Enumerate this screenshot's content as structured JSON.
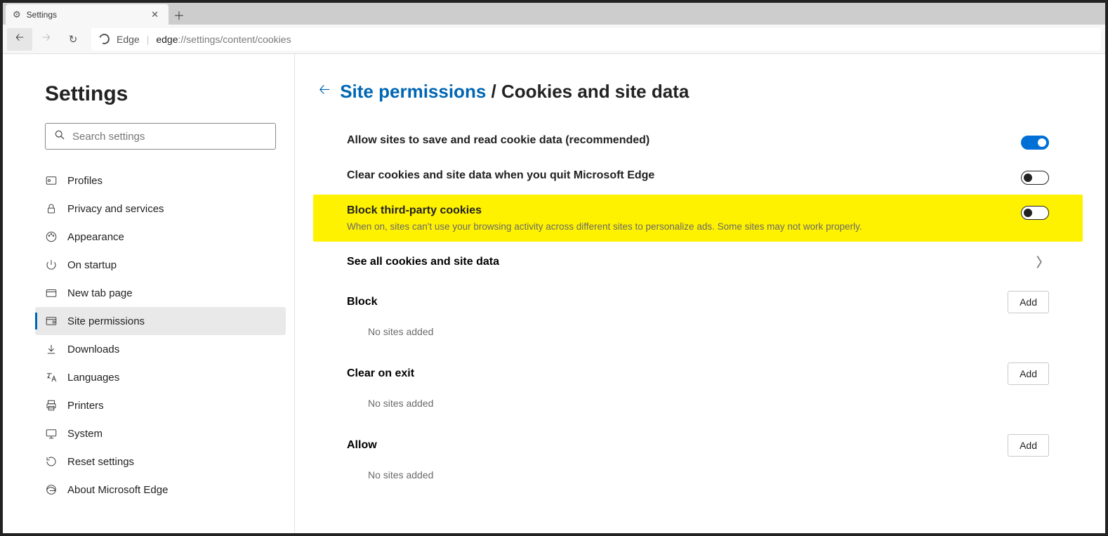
{
  "tab": {
    "title": "Settings"
  },
  "addressbar": {
    "label": "Edge",
    "url_bold": "edge",
    "url_rest": "://settings/content/cookies"
  },
  "sidebar": {
    "title": "Settings",
    "search_placeholder": "Search settings",
    "items": [
      {
        "label": "Profiles",
        "icon": "card"
      },
      {
        "label": "Privacy and services",
        "icon": "lock"
      },
      {
        "label": "Appearance",
        "icon": "palette"
      },
      {
        "label": "On startup",
        "icon": "power"
      },
      {
        "label": "New tab page",
        "icon": "tab"
      },
      {
        "label": "Site permissions",
        "icon": "perm",
        "active": true
      },
      {
        "label": "Downloads",
        "icon": "download"
      },
      {
        "label": "Languages",
        "icon": "lang"
      },
      {
        "label": "Printers",
        "icon": "printer"
      },
      {
        "label": "System",
        "icon": "system"
      },
      {
        "label": "Reset settings",
        "icon": "reset"
      },
      {
        "label": "About Microsoft Edge",
        "icon": "edge"
      }
    ]
  },
  "breadcrumb": {
    "parent": "Site permissions",
    "sep": "/",
    "current": "Cookies and site data"
  },
  "settings": {
    "allow": {
      "title": "Allow sites to save and read cookie data (recommended)",
      "on": true
    },
    "clear_on_quit": {
      "title": "Clear cookies and site data when you quit Microsoft Edge",
      "on": false
    },
    "block_3p": {
      "title": "Block third-party cookies",
      "sub": "When on, sites can't use your browsing activity across different sites to personalize ads. Some sites may not work properly.",
      "on": false,
      "highlighted": true
    },
    "see_all": {
      "title": "See all cookies and site data"
    }
  },
  "sections": {
    "block": {
      "title": "Block",
      "add": "Add",
      "empty": "No sites added"
    },
    "clear_on_exit": {
      "title": "Clear on exit",
      "add": "Add",
      "empty": "No sites added"
    },
    "allow": {
      "title": "Allow",
      "add": "Add",
      "empty": "No sites added"
    }
  }
}
